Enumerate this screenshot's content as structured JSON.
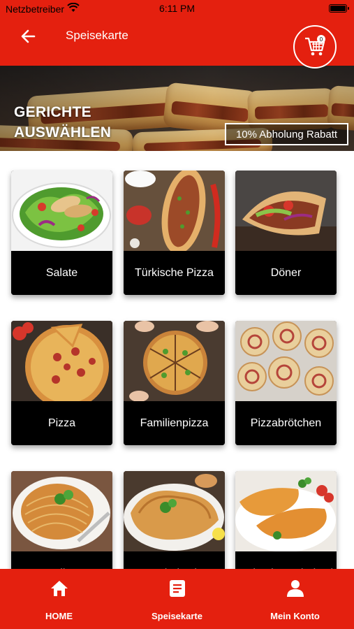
{
  "status_bar": {
    "carrier": "Netzbetreiber",
    "time": "6:11 PM"
  },
  "header": {
    "title": "Speisekarte",
    "cart_count": "0"
  },
  "banner": {
    "title_line1": "GERICHTE",
    "title_line2": "AUSWÄHLEN",
    "discount": "10% Abholung Rabatt"
  },
  "categories": [
    {
      "label": "Salate"
    },
    {
      "label": "Türkische Pizza"
    },
    {
      "label": "Döner"
    },
    {
      "label": "Pizza"
    },
    {
      "label": "Familienpizza"
    },
    {
      "label": "Pizzabrötchen"
    },
    {
      "label": "Teller"
    },
    {
      "label": "Schnitzel"
    },
    {
      "label": "Hähnchenschnitzel"
    }
  ],
  "bottom_nav": {
    "items": [
      {
        "label": "HOME",
        "icon": "home-icon"
      },
      {
        "label": "Speisekarte",
        "icon": "menu-list-icon"
      },
      {
        "label": "Mein Konto",
        "icon": "account-icon"
      }
    ]
  },
  "colors": {
    "accent": "#e4200f",
    "card_label_bg": "#000000",
    "text_on_accent": "#ffffff"
  }
}
